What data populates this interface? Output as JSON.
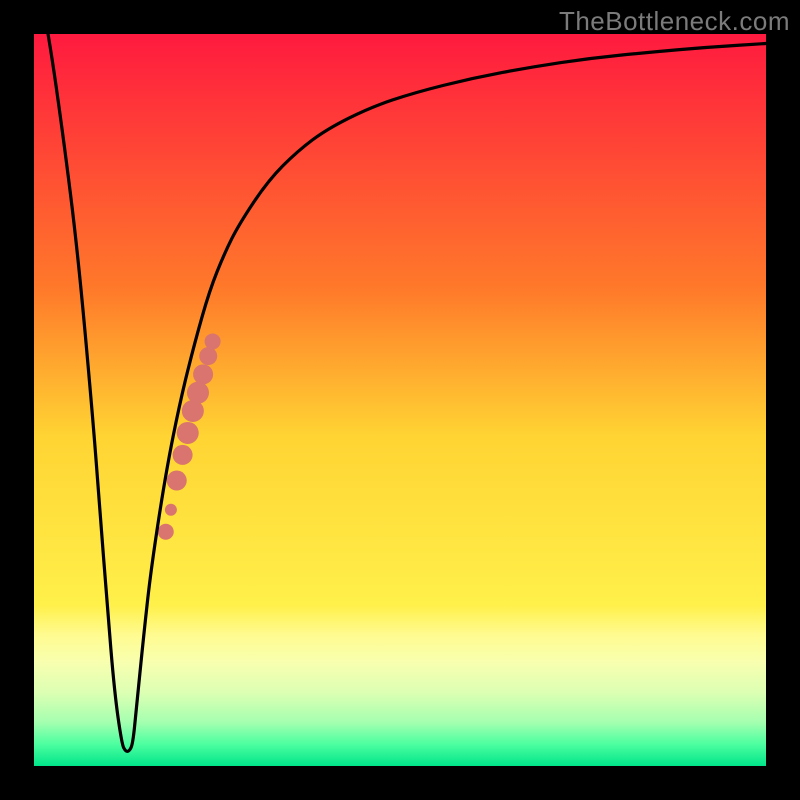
{
  "watermark": "TheBottleneck.com",
  "chart_data": {
    "type": "line",
    "title": "",
    "xlabel": "",
    "ylabel": "",
    "xlim": [
      0,
      100
    ],
    "ylim": [
      0,
      100
    ],
    "gradient_stops": [
      {
        "offset": 0.0,
        "color": "#ff1a3f"
      },
      {
        "offset": 0.35,
        "color": "#ff7a2a"
      },
      {
        "offset": 0.55,
        "color": "#ffd433"
      },
      {
        "offset": 0.78,
        "color": "#fff04a"
      },
      {
        "offset": 0.82,
        "color": "#fffb8f"
      },
      {
        "offset": 0.86,
        "color": "#f7ffb0"
      },
      {
        "offset": 0.9,
        "color": "#dcffb3"
      },
      {
        "offset": 0.94,
        "color": "#a5ffb0"
      },
      {
        "offset": 0.97,
        "color": "#4dffa0"
      },
      {
        "offset": 1.0,
        "color": "#00e58a"
      }
    ],
    "series": [
      {
        "name": "bottleneck-curve",
        "x": [
          0,
          2,
          4,
          6,
          8,
          9,
          10,
          11,
          12,
          12.5,
          13,
          13.5,
          14,
          15,
          16,
          18,
          20,
          22,
          24,
          26,
          28,
          32,
          36,
          40,
          46,
          52,
          60,
          68,
          76,
          84,
          92,
          100
        ],
        "y": [
          110,
          100,
          86,
          70,
          48,
          35,
          22,
          10,
          3,
          2,
          2,
          3,
          8,
          18,
          27,
          40,
          50,
          58,
          65,
          70,
          74,
          80,
          84,
          87,
          90,
          92,
          94,
          95.5,
          96.7,
          97.5,
          98.2,
          98.7
        ]
      }
    ],
    "scatter": {
      "name": "highlight-dots",
      "color": "#d9746e",
      "points": [
        {
          "x": 18.0,
          "y": 32.0,
          "r": 8
        },
        {
          "x": 18.7,
          "y": 35.0,
          "r": 6
        },
        {
          "x": 19.5,
          "y": 39.0,
          "r": 10
        },
        {
          "x": 20.3,
          "y": 42.5,
          "r": 10
        },
        {
          "x": 21.0,
          "y": 45.5,
          "r": 11
        },
        {
          "x": 21.7,
          "y": 48.5,
          "r": 11
        },
        {
          "x": 22.4,
          "y": 51.0,
          "r": 11
        },
        {
          "x": 23.1,
          "y": 53.5,
          "r": 10
        },
        {
          "x": 23.8,
          "y": 56.0,
          "r": 9
        },
        {
          "x": 24.4,
          "y": 58.0,
          "r": 8
        }
      ]
    }
  }
}
